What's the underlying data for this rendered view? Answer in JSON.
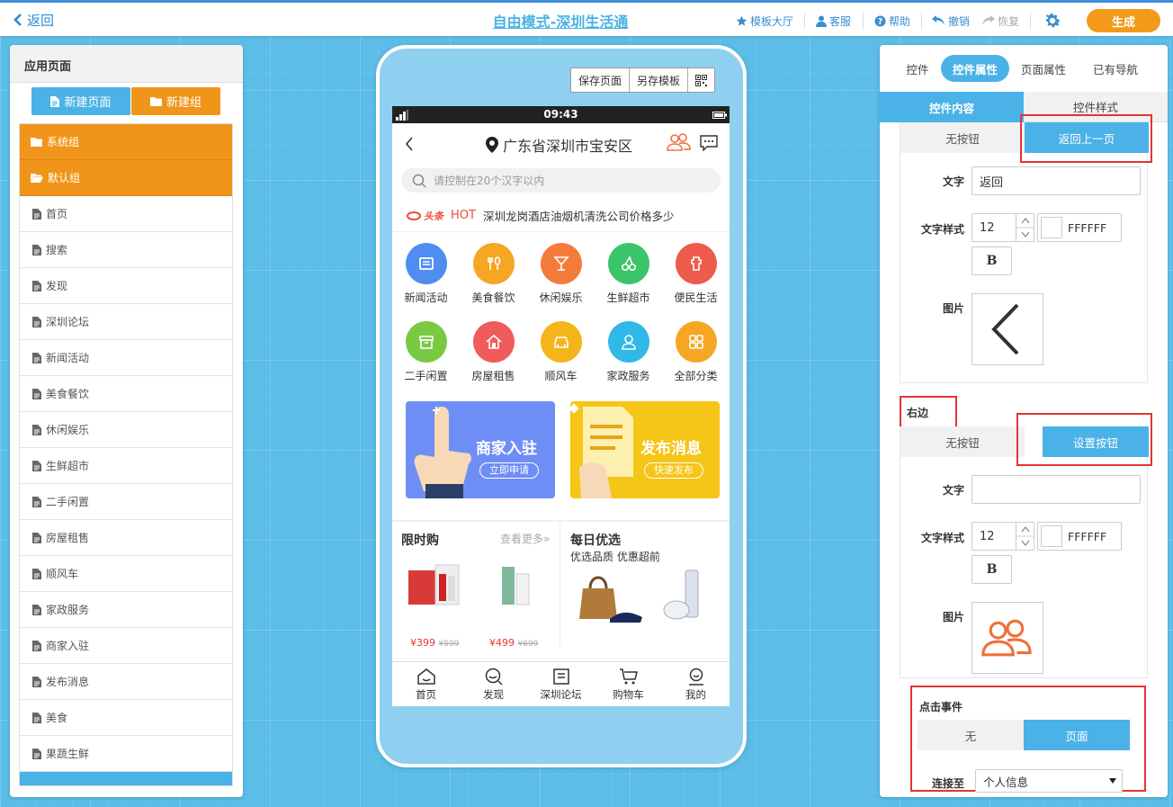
{
  "topbar": {
    "back_label": "返回",
    "title": "自由模式-深圳生活通",
    "items": {
      "templates": "模板大厅",
      "service": "客服",
      "help": "帮助",
      "undo": "撤销",
      "redo": "恢复"
    },
    "generate_label": "生成"
  },
  "left": {
    "title": "应用页面",
    "new_page": "新建页面",
    "new_group": "新建组",
    "groups": [
      "系统组",
      "默认组"
    ],
    "pages": [
      "首页",
      "搜索",
      "发现",
      "深圳论坛",
      "新闻活动",
      "美食餐饮",
      "休闲娱乐",
      "生鲜超市",
      "二手闲置",
      "房屋租售",
      "顺风车",
      "家政服务",
      "商家入驻",
      "发布消息",
      "美食",
      "果蔬生鲜"
    ]
  },
  "phone": {
    "buttons": {
      "save": "保存页面",
      "save_template": "另存模板"
    },
    "time": "09:43",
    "location": "广东省深圳市宝安区",
    "search_placeholder": "请控制在20个汉字以内",
    "news": {
      "source": "头条",
      "hot": "HOT",
      "text": "深圳龙岗酒店油烟机清洗公司价格多少"
    },
    "categories": [
      {
        "label": "新闻活动",
        "color": "#4f8ef0",
        "icon": "newspaper-icon"
      },
      {
        "label": "美食餐饮",
        "color": "#f5a623",
        "icon": "fork-spoon-icon"
      },
      {
        "label": "休闲娱乐",
        "color": "#f57b3a",
        "icon": "cocktail-icon"
      },
      {
        "label": "生鲜超市",
        "color": "#3cc46b",
        "icon": "cherry-icon"
      },
      {
        "label": "便民生活",
        "color": "#ee5a4b",
        "icon": "hydrant-icon"
      },
      {
        "label": "二手闲置",
        "color": "#7ac943",
        "icon": "box-icon"
      },
      {
        "label": "房屋租售",
        "color": "#f05b5b",
        "icon": "house-icon"
      },
      {
        "label": "顺风车",
        "color": "#f3b51b",
        "icon": "car-icon"
      },
      {
        "label": "家政服务",
        "color": "#2fb8e8",
        "icon": "person-icon"
      },
      {
        "label": "全部分类",
        "color": "#f5a623",
        "icon": "grid-icon"
      }
    ],
    "banners": [
      {
        "title": "商家入驻",
        "sub": "立即申请",
        "color": "#6f8ef5"
      },
      {
        "title": "发布消息",
        "sub": "快速发布",
        "color": "#f5c518"
      }
    ],
    "promo": {
      "flash_title": "限时购",
      "more": "查看更多»",
      "price1": "¥399",
      "old1": "¥599",
      "price2": "¥499",
      "old2": "¥699",
      "daily_title": "每日优选",
      "daily_sub": "优选品质 优惠超前"
    },
    "nav": [
      "首页",
      "发现",
      "深圳论坛",
      "购物车",
      "我的"
    ]
  },
  "right": {
    "tabs": [
      "控件",
      "控件属性",
      "页面属性",
      "已有导航"
    ],
    "subtabs": [
      "控件内容",
      "控件样式"
    ],
    "left_btn": {
      "seg": [
        "无按钮",
        "返回上一页"
      ],
      "text_label": "文字",
      "text_value": "返回",
      "style_label": "文字样式",
      "font_size": "12",
      "color": "FFFFFF",
      "bold": "B",
      "image_label": "图片"
    },
    "right_btn": {
      "section": "右边",
      "seg": [
        "无按钮",
        "设置按钮"
      ],
      "text_label": "文字",
      "text_value": "",
      "style_label": "文字样式",
      "font_size": "12",
      "color": "FFFFFF",
      "bold": "B",
      "image_label": "图片"
    },
    "click": {
      "title": "点击事件",
      "seg": [
        "无",
        "页面"
      ],
      "link_label": "连接至",
      "link_value": "个人信息"
    }
  }
}
